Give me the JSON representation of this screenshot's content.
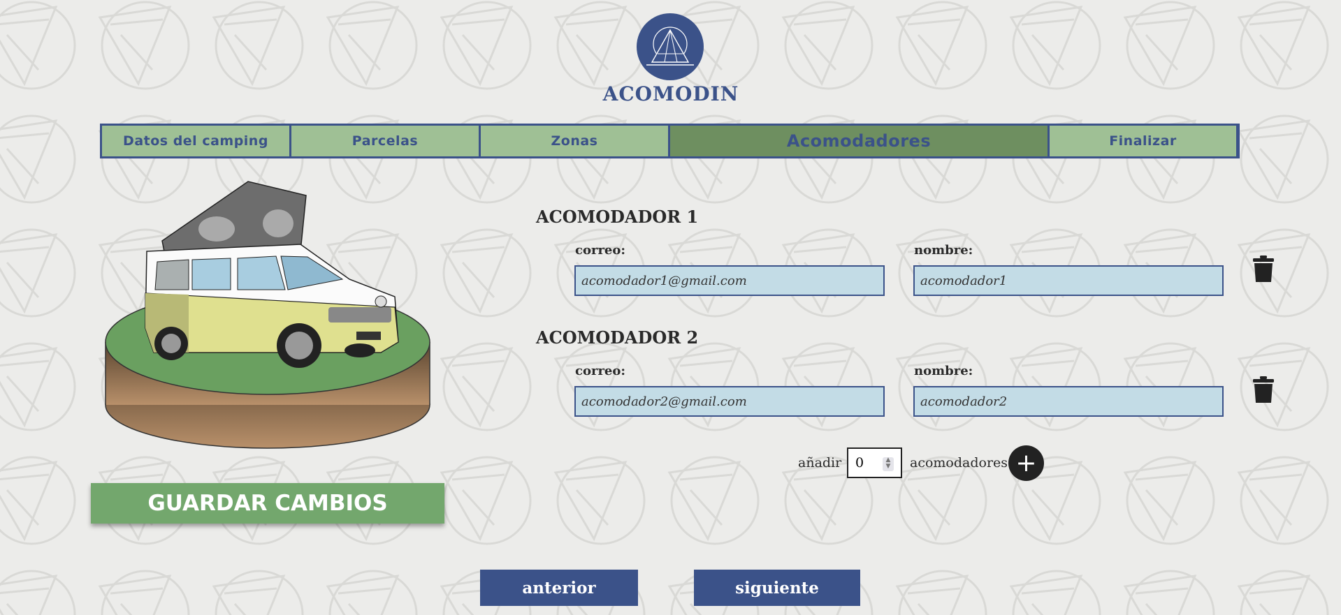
{
  "brand": {
    "name": "ACOMODIN",
    "logo_icon": "tent-icon",
    "logo_color": "#3b5289"
  },
  "tabs": [
    {
      "label": "Datos del camping",
      "active": false
    },
    {
      "label": "Parcelas",
      "active": false
    },
    {
      "label": "Zonas",
      "active": false
    },
    {
      "label": "Acomodadores",
      "active": true
    },
    {
      "label": "Finalizar",
      "active": false
    }
  ],
  "illustration": {
    "icon": "camper-van-icon"
  },
  "save_button": {
    "label": "GUARDAR CAMBIOS"
  },
  "acomodadores": [
    {
      "heading": "ACOMODADOR 1",
      "email_label": "correo:",
      "email_value": "acomodador1@gmail.com",
      "name_label": "nombre:",
      "name_value": "acomodador1",
      "delete_icon": "trash-icon"
    },
    {
      "heading": "ACOMODADOR 2",
      "email_label": "correo:",
      "email_value": "acomodador2@gmail.com",
      "name_label": "nombre:",
      "name_value": "acomodador2",
      "delete_icon": "trash-icon"
    }
  ],
  "add_row": {
    "prefix": "añadir",
    "count": "0",
    "suffix": "acomodadores",
    "add_icon": "plus-icon"
  },
  "nav": {
    "prev_label": "anterior",
    "next_label": "siguiente"
  },
  "colors": {
    "accent": "#3b5289",
    "tab_bg": "#9fc095",
    "tab_active_bg": "#6e8f60",
    "save_bg": "#73a76d",
    "field_bg": "#c3dce6"
  }
}
